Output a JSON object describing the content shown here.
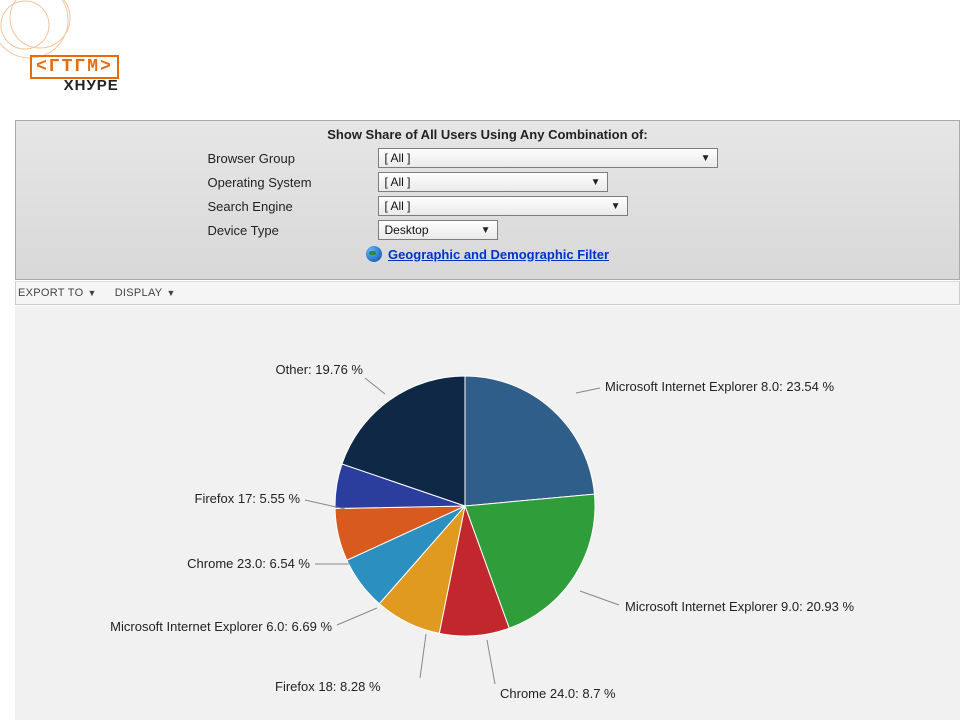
{
  "logo": {
    "line1": "<ГТГМ>",
    "line2": "ХНУРЕ"
  },
  "filter": {
    "title": "Show Share of All Users Using Any Combination of:",
    "rows": {
      "browser_group": {
        "label": "Browser Group",
        "value": "[ All ]"
      },
      "operating_system": {
        "label": "Operating System",
        "value": "[ All ]"
      },
      "search_engine": {
        "label": "Search Engine",
        "value": "[ All ]"
      },
      "device_type": {
        "label": "Device Type",
        "value": "Desktop"
      }
    },
    "geo_link": "Geographic and Demographic Filter"
  },
  "toolbar": {
    "export_to": "EXPORT TO",
    "display": "DISPLAY"
  },
  "chart_data": {
    "type": "pie",
    "title": "",
    "series": [
      {
        "name": "Microsoft Internet Explorer 8.0",
        "value": 23.54,
        "color": "#2f5e8a"
      },
      {
        "name": "Microsoft Internet Explorer 9.0",
        "value": 20.93,
        "color": "#2f9e3a"
      },
      {
        "name": "Chrome 24.0",
        "value": 8.7,
        "color": "#c1272d"
      },
      {
        "name": "Firefox 18",
        "value": 8.28,
        "color": "#e09a1f"
      },
      {
        "name": "Microsoft Internet Explorer 6.0",
        "value": 6.69,
        "color": "#2b8fc0"
      },
      {
        "name": "Chrome 23.0",
        "value": 6.54,
        "color": "#d85a1f"
      },
      {
        "name": "Firefox 17",
        "value": 5.55,
        "color": "#2b3e9e"
      },
      {
        "name": "Other",
        "value": 19.76,
        "color": "#0f2846"
      }
    ]
  },
  "labels": {
    "ie8": "Microsoft Internet Explorer 8.0: 23.54 %",
    "ie9": "Microsoft Internet Explorer 9.0: 20.93 %",
    "chrome24": "Chrome 24.0: 8.7 %",
    "firefox18": "Firefox 18: 8.28 %",
    "ie6": "Microsoft Internet Explorer 6.0: 6.69 %",
    "chrome23": "Chrome 23.0: 6.54 %",
    "firefox17": "Firefox 17: 5.55 %",
    "other": "Other: 19.76 %"
  }
}
